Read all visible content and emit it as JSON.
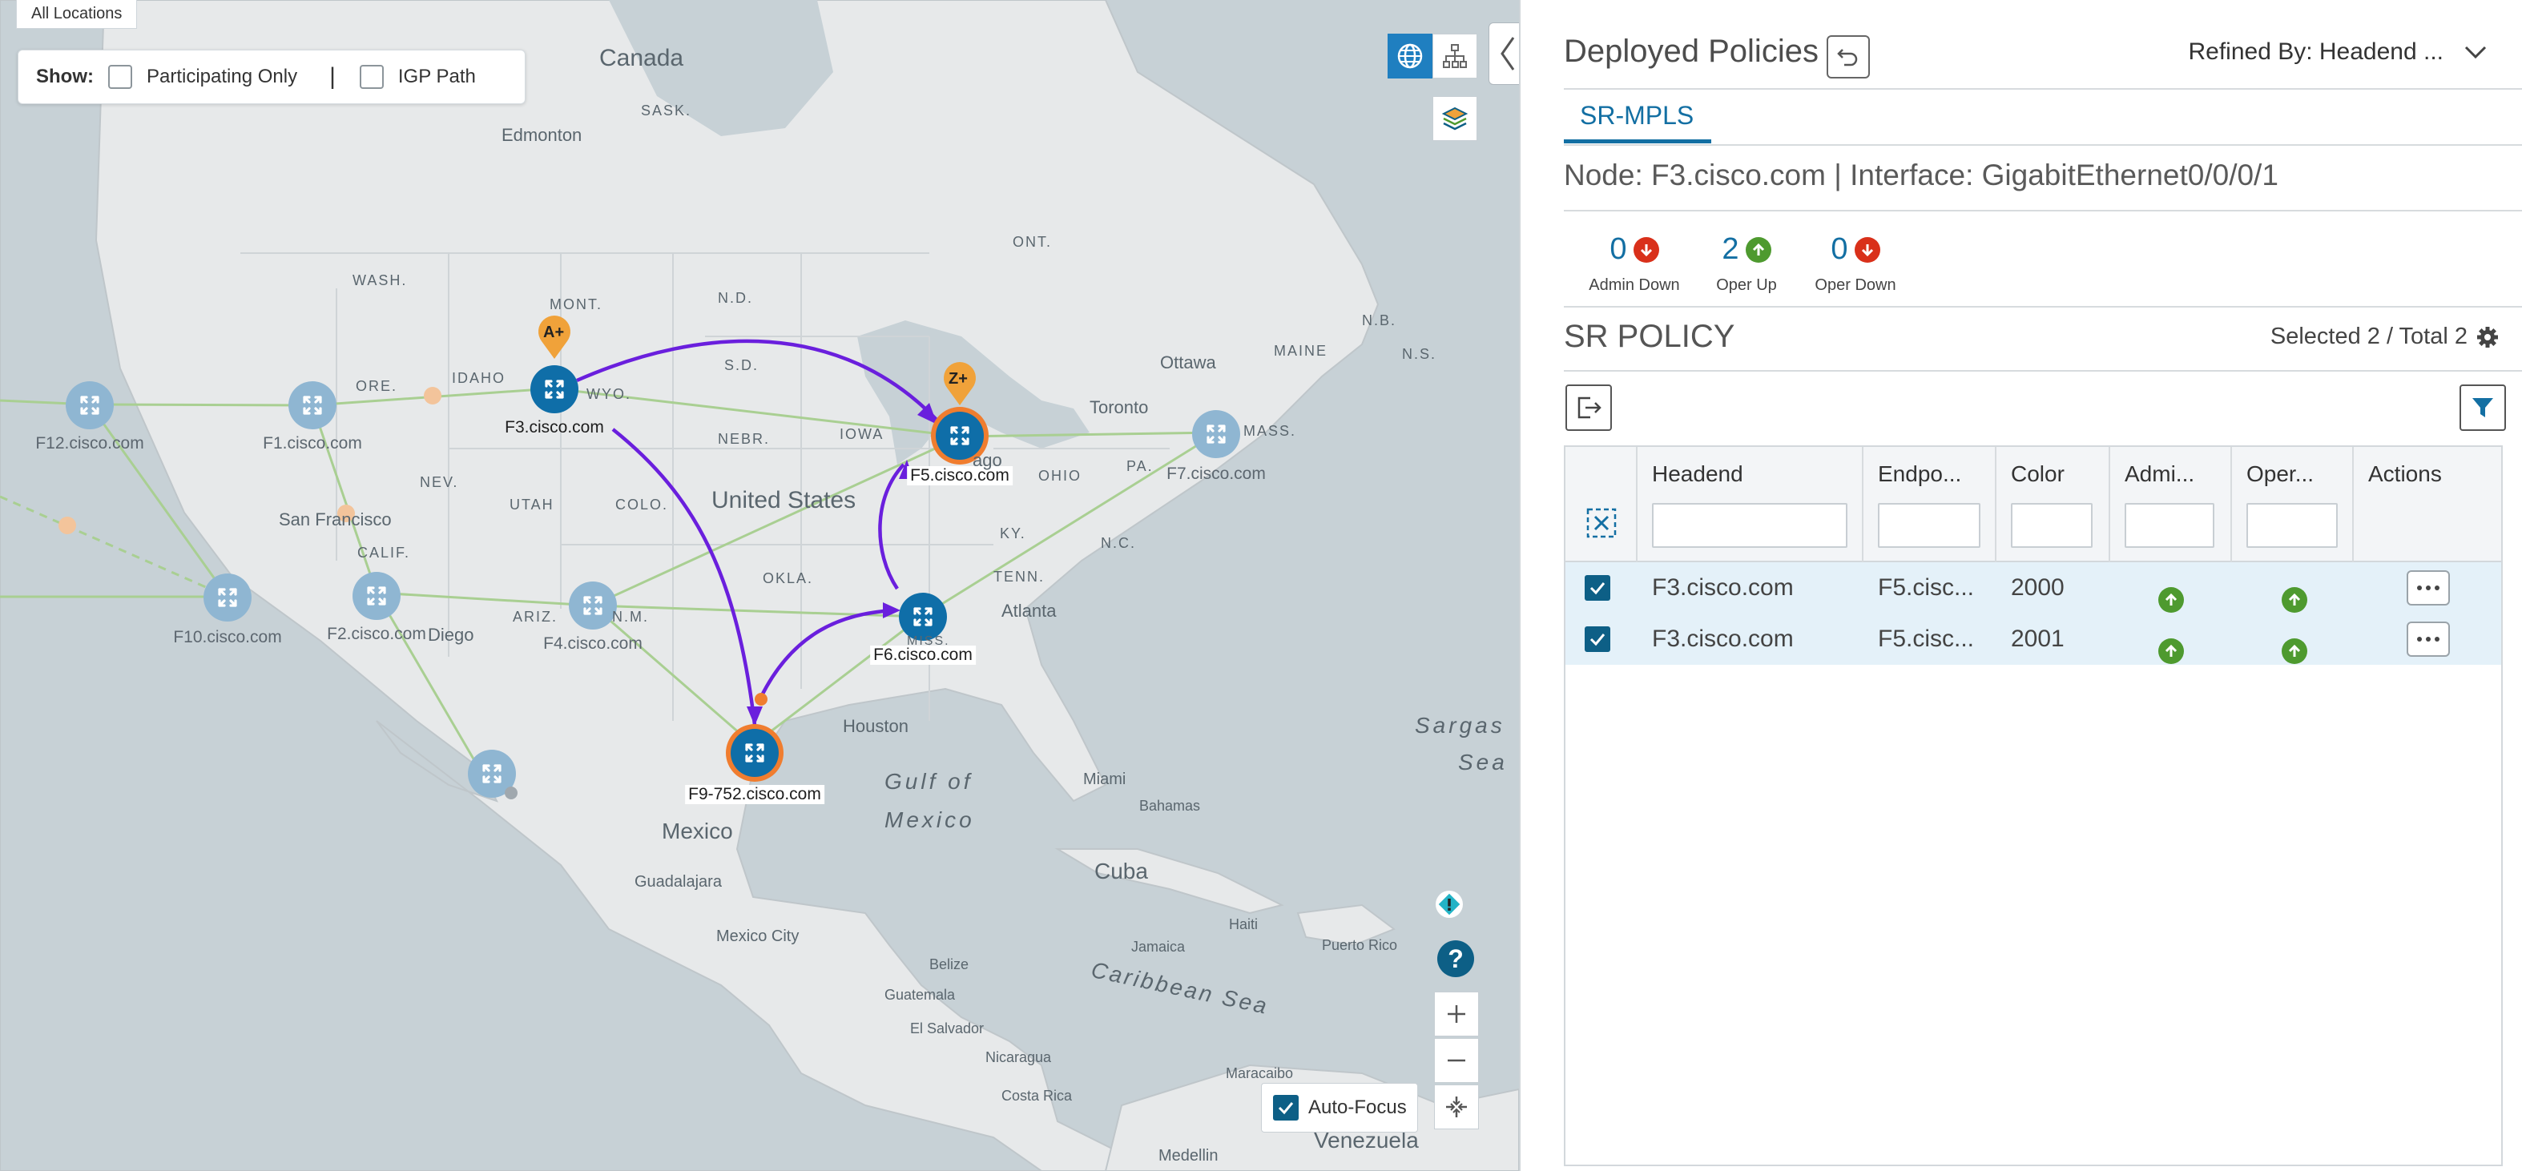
{
  "map": {
    "location_tag": "All Locations",
    "show_label": "Show:",
    "participating_only": "Participating Only",
    "separator": "|",
    "igp_path": "IGP Path",
    "auto_focus": "Auto-Focus",
    "nodes": {
      "f3": "F3.cisco.com",
      "f5": "F5.cisco.com",
      "f6": "F6.cisco.com",
      "f9": "F9-752.cisco.com",
      "f1": "F1.cisco.com",
      "f12": "F12.cisco.com",
      "f10": "F10.cisco.com",
      "f2": "F2.cisco.com",
      "f4": "F4.cisco.com",
      "f7": "F7.cisco.com"
    },
    "markers": {
      "a": "A+",
      "z": "Z+"
    },
    "places": {
      "canada": "Canada",
      "united_states": "United States",
      "mexico": "Mexico",
      "gulf_of_mexico_1": "Gulf of",
      "gulf_of_mexico_2": "Mexico",
      "cuba": "Cuba",
      "caribbean_sea": "Caribbean Sea",
      "sargasso_1": "Sargas",
      "sargasso_2": "Sea",
      "venezuela": "Venezuela",
      "edmonton": "Edmonton",
      "ottawa": "Ottawa",
      "toronto": "Toronto",
      "houston": "Houston",
      "atlanta": "Atlanta",
      "miami": "Miami",
      "san_francisco": "San Francisco",
      "bahamas": "Bahamas",
      "haiti": "Haiti",
      "puerto_rico": "Puerto Rico",
      "jamaica": "Jamaica",
      "belize": "Belize",
      "guatemala": "Guatemala",
      "el_salvador": "El Salvador",
      "nicaragua": "Nicaragua",
      "costa_rica": "Costa Rica",
      "guadalajara": "Guadalajara",
      "mexico_city": "Mexico City",
      "maracaibo": "Maracaibo",
      "medellin": "Medellin",
      "wash": "WASH.",
      "ore": "ORE.",
      "idaho": "IDAHO",
      "mont": "MONT.",
      "wyo": "WYO.",
      "nev": "NEV.",
      "utah": "UTAH",
      "colo": "COLO.",
      "calif": "CALIF.",
      "ariz": "ARIZ.",
      "nm": "N.M.",
      "nd": "N.D.",
      "sd": "S.D.",
      "nebr": "NEBR.",
      "iowa": "IOWA",
      "okla": "OKLA.",
      "ohio": "OHIO",
      "ky": "KY.",
      "tenn": "TENN.",
      "nc": "N.C.",
      "pa": "PA.",
      "miss": "MISS.",
      "sask": "SASK.",
      "ont": "ONT.",
      "maine": "MAINE",
      "nb": "N.B.",
      "ns": "N.S.",
      "mass": "MASS.",
      "diego": "Diego",
      "chicago_part": "ago"
    }
  },
  "panel": {
    "title": "Deployed Policies",
    "refined_by": "Refined By: Headend ...",
    "tab": "SR-MPLS",
    "node_info": "Node: F3.cisco.com | Interface: GigabitEthernet0/0/0/1",
    "stats": [
      {
        "value": "0",
        "label": "Admin Down",
        "dir": "down"
      },
      {
        "value": "2",
        "label": "Oper Up",
        "dir": "up"
      },
      {
        "value": "0",
        "label": "Oper Down",
        "dir": "down"
      }
    ],
    "section_title": "SR POLICY",
    "selected_total": "Selected 2 / Total 2",
    "columns": [
      "Headend",
      "Endpo...",
      "Color",
      "Admi...",
      "Oper...",
      "Actions"
    ],
    "rows": [
      {
        "headend": "F3.cisco.com",
        "endpoint": "F5.cisc...",
        "color": "2000",
        "admin": "up",
        "oper": "up"
      },
      {
        "headend": "F3.cisco.com",
        "endpoint": "F5.cisc...",
        "color": "2001",
        "admin": "up",
        "oper": "up"
      }
    ],
    "colors": {
      "accent": "#136fa3",
      "up": "#4e9a2f",
      "down": "#d9301a",
      "row_selected": "#e4f1f9"
    }
  }
}
